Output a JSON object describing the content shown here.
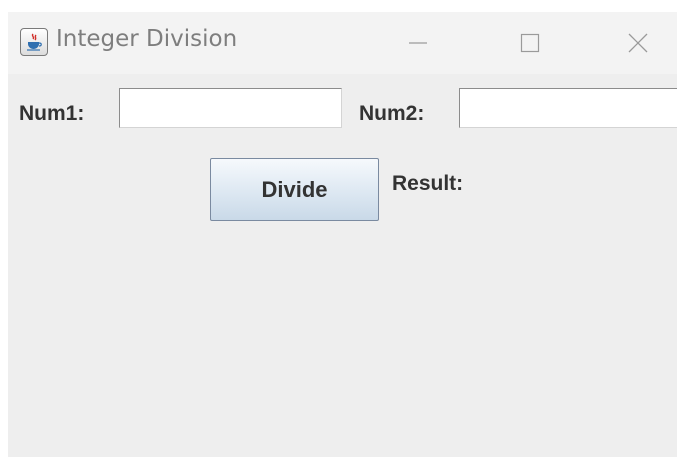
{
  "window": {
    "title": "Integer Division",
    "icon": "java-coffee-icon"
  },
  "title_bar_controls": {
    "minimize": "minimize-icon",
    "maximize": "maximize-icon",
    "close": "close-icon"
  },
  "form": {
    "num1_label": "Num1:",
    "num1_value": "",
    "num2_label": "Num2:",
    "num2_value": "",
    "divide_label": "Divide",
    "result_label": "Result:"
  },
  "colors": {
    "window_background": "#eeeeee",
    "title_bar": "#f3f3f3",
    "title_text": "#7e7e7e",
    "label_text": "#333333",
    "button_gradient_top": "#f6f9fc",
    "button_gradient_bottom": "#c9d9e8"
  }
}
